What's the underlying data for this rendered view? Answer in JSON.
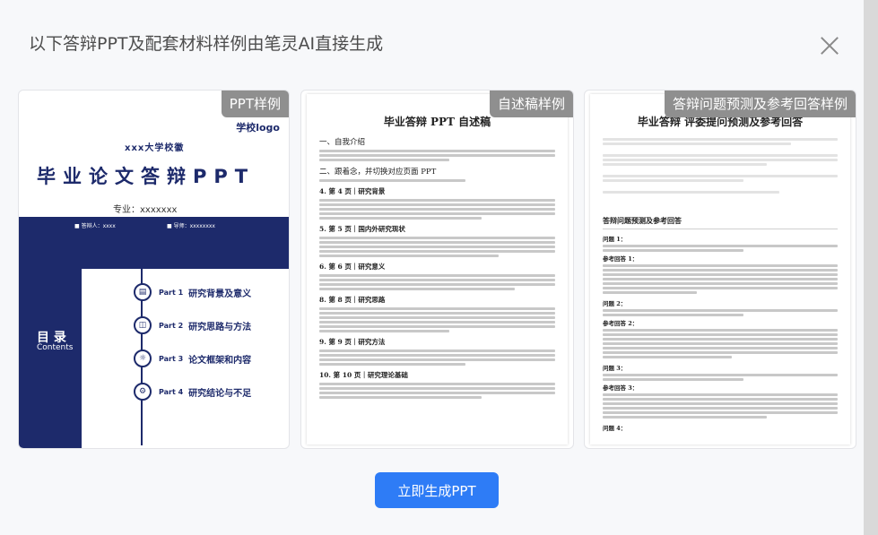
{
  "dialog": {
    "title": "以下答辩PPT及配套材料样例由笔灵AI直接生成",
    "close_icon": "close-icon"
  },
  "cards": [
    {
      "badge": "PPT样例"
    },
    {
      "badge": "自述稿样例"
    },
    {
      "badge": "答辩问题预测及参考回答样例"
    }
  ],
  "slide": {
    "logo": "学校logo",
    "school": "xxx大学校徽",
    "title": "毕业论文答辩PPT",
    "major": "专业：xxxxxxx",
    "presenter": "答辩人：xxxx",
    "advisor": "导师：xxxxxxxx",
    "toc_title": "目 录",
    "toc_subtitle": "Contents",
    "toc": [
      {
        "part": "Part 1",
        "label": "研究背景及意义",
        "icon": "document-icon"
      },
      {
        "part": "Part 2",
        "label": "研究思路与方法",
        "icon": "flowchart-icon"
      },
      {
        "part": "Part 3",
        "label": "论文框架和内容",
        "icon": "lightbulb-icon"
      },
      {
        "part": "Part 4",
        "label": "研究结论与不足",
        "icon": "gears-icon"
      }
    ]
  },
  "speech": {
    "title": "毕业答辩 PPT 自述稿",
    "sections": [
      {
        "heading": "一、自我介绍",
        "lines": 3
      },
      {
        "heading": "二、跟着念，并切换对应页面 PPT",
        "lines": 1
      },
      {
        "heading": "4. 第 4 页｜研究背景",
        "lines": 5,
        "bold": true
      },
      {
        "heading": "5. 第 5 页｜国内外研究现状",
        "lines": 5,
        "bold": true
      },
      {
        "heading": "6. 第 6 页｜研究意义",
        "lines": 4,
        "bold": true
      },
      {
        "heading": "8. 第 8 页｜研究思路",
        "lines": 6,
        "bold": true
      },
      {
        "heading": "9. 第 9 页｜研究方法",
        "lines": 4,
        "bold": true
      },
      {
        "heading": "10. 第 10 页｜研究理论基础",
        "lines": 4,
        "bold": true
      }
    ]
  },
  "qa": {
    "title": "毕业答辩 评委提问预测及参考回答",
    "section_title": "答辩问题预测及参考回答",
    "questions": [
      {
        "q": "问题 1：",
        "a": "参考回答 1：",
        "lines": 7
      },
      {
        "q": "问题 2：",
        "a": "参考回答 2：",
        "lines": 7
      },
      {
        "q": "问题 3：",
        "a": "参考回答 3：",
        "lines": 6
      },
      {
        "q": "问题 4：",
        "a": "",
        "lines": 0
      }
    ]
  },
  "action": {
    "generate_label": "立即生成PPT"
  }
}
